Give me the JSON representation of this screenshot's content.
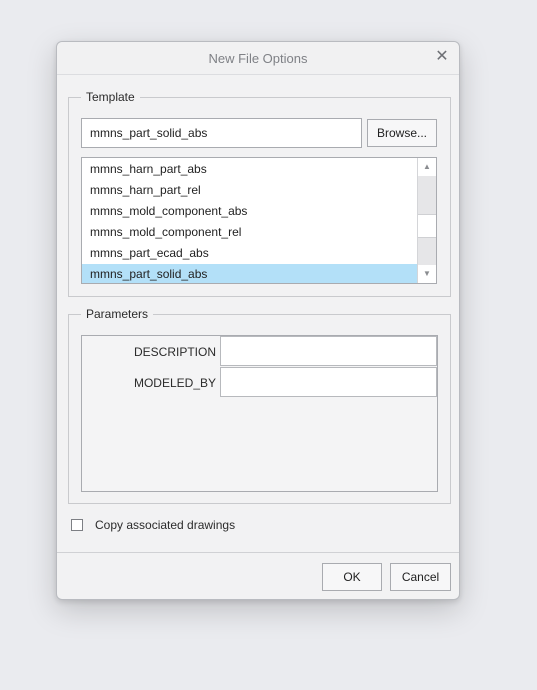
{
  "dialog": {
    "title": "New File Options",
    "close_icon": "close-icon"
  },
  "template": {
    "legend": "Template",
    "input_value": "mmns_part_solid_abs",
    "browse_label": "Browse...",
    "items": [
      {
        "label": "mmns_harn_part_abs",
        "selected": false
      },
      {
        "label": "mmns_harn_part_rel",
        "selected": false
      },
      {
        "label": "mmns_mold_component_abs",
        "selected": false
      },
      {
        "label": "mmns_mold_component_rel",
        "selected": false
      },
      {
        "label": "mmns_part_ecad_abs",
        "selected": false
      },
      {
        "label": "mmns_part_solid_abs",
        "selected": true
      }
    ],
    "scrollbar_icons": {
      "up": "scroll-up-arrow-icon",
      "down": "scroll-down-arrow-icon"
    }
  },
  "parameters": {
    "legend": "Parameters",
    "rows": [
      {
        "label": "DESCRIPTION",
        "value": ""
      },
      {
        "label": "MODELED_BY",
        "value": ""
      }
    ]
  },
  "options": {
    "copy_drawings_label": "Copy associated drawings",
    "copy_drawings_checked": false
  },
  "buttons": {
    "ok_label": "OK",
    "cancel_label": "Cancel"
  },
  "colors": {
    "selection": "#b3e0f8",
    "background": "#eaebef",
    "dialog_bg": "#f2f2f3"
  }
}
